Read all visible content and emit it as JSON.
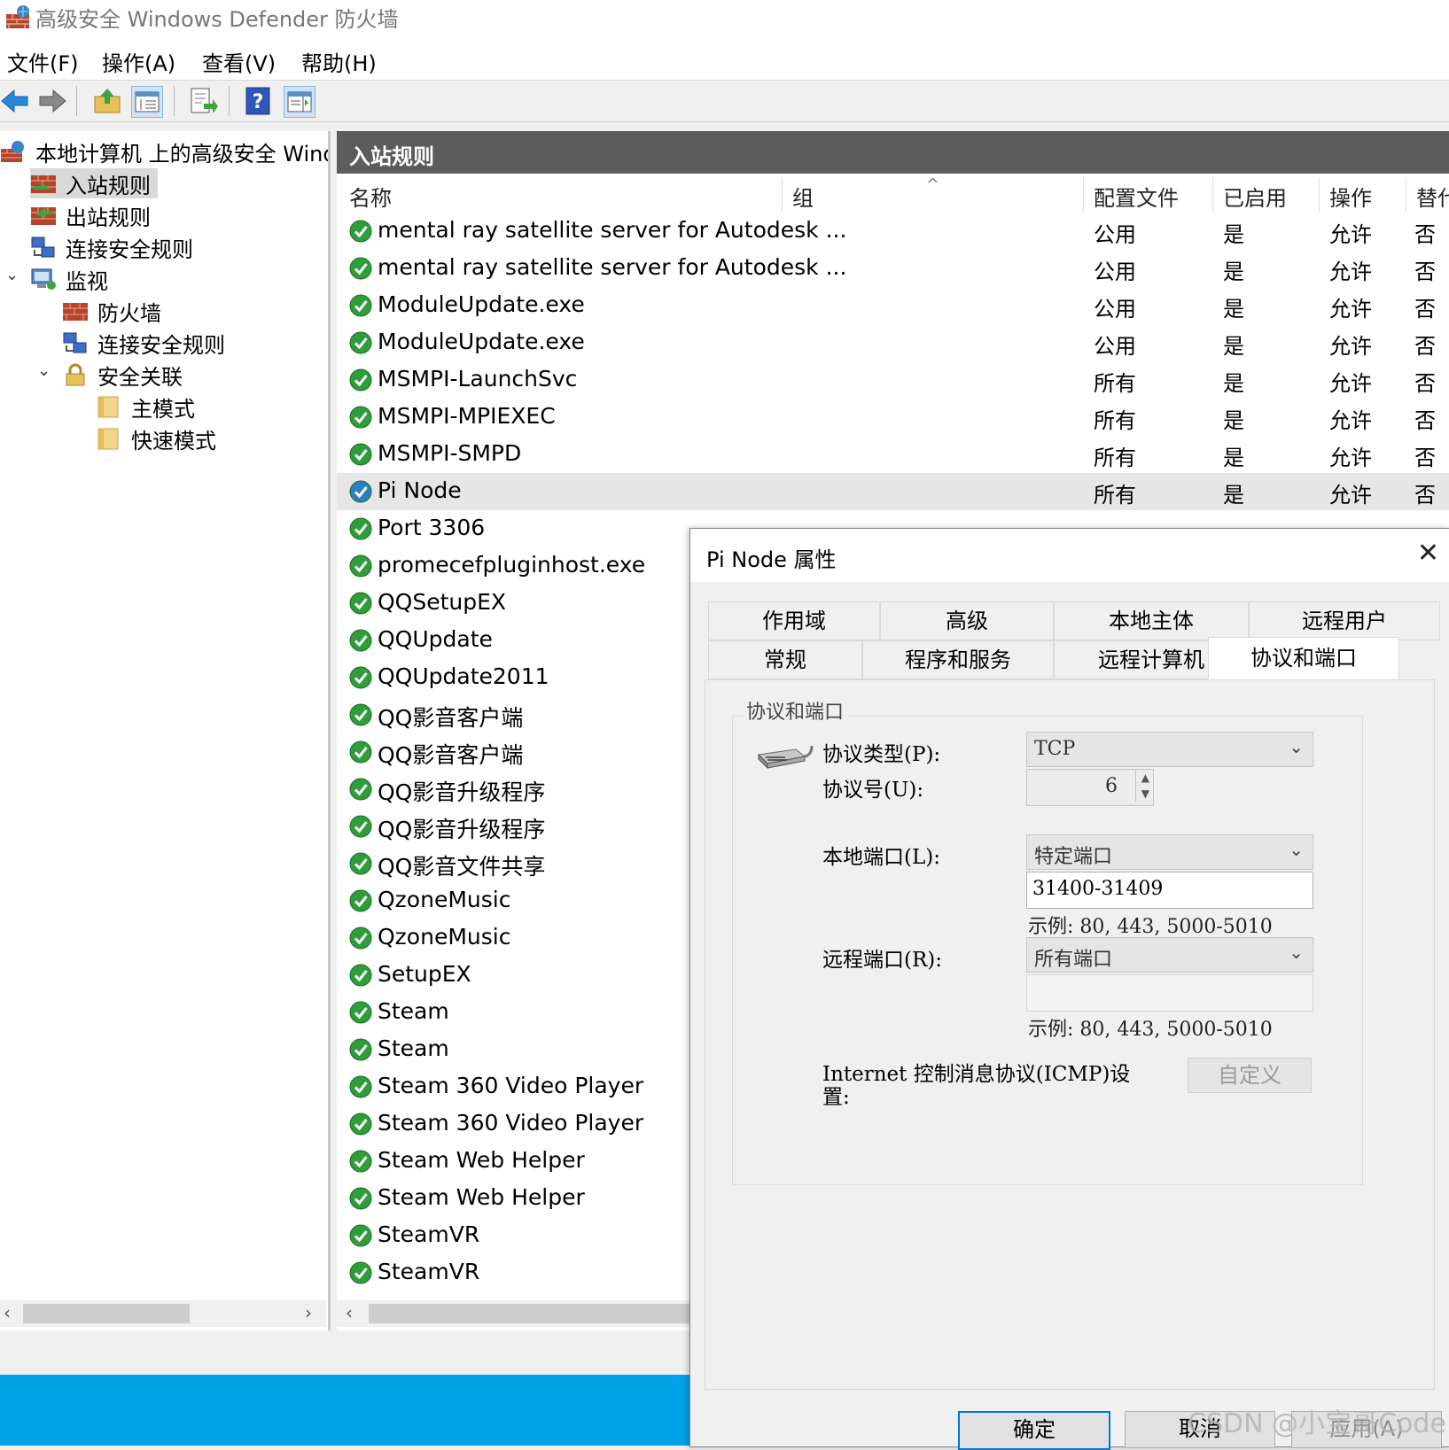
{
  "window": {
    "title": "高级安全 Windows Defender 防火墙"
  },
  "menu": [
    "文件(F)",
    "操作(A)",
    "查看(V)",
    "帮助(H)"
  ],
  "toolbar": [
    "back-icon",
    "forward-icon",
    "up-folder-icon",
    "show-hide-console-icon",
    "export-list-icon",
    "help-icon",
    "action-pane-icon"
  ],
  "tree": {
    "root": "本地计算机 上的高级安全 Windows Defender 防火墙",
    "items": [
      "入站规则",
      "出站规则",
      "连接安全规则",
      "监视"
    ],
    "monitor_children": [
      "防火墙",
      "连接安全规则",
      "安全关联"
    ],
    "sa_children": [
      "主模式",
      "快速模式"
    ]
  },
  "list": {
    "header": "入站规则",
    "columns": [
      "名称",
      "组",
      "配置文件",
      "已启用",
      "操作",
      "替代"
    ],
    "rows": [
      {
        "name": "mental ray satellite server for Autodesk ...",
        "profile": "公用",
        "enabled": "是",
        "action": "允许",
        "override": "否"
      },
      {
        "name": "mental ray satellite server for Autodesk ...",
        "profile": "公用",
        "enabled": "是",
        "action": "允许",
        "override": "否"
      },
      {
        "name": "ModuleUpdate.exe",
        "profile": "公用",
        "enabled": "是",
        "action": "允许",
        "override": "否"
      },
      {
        "name": "ModuleUpdate.exe",
        "profile": "公用",
        "enabled": "是",
        "action": "允许",
        "override": "否"
      },
      {
        "name": "MSMPI-LaunchSvc",
        "profile": "所有",
        "enabled": "是",
        "action": "允许",
        "override": "否"
      },
      {
        "name": "MSMPI-MPIEXEC",
        "profile": "所有",
        "enabled": "是",
        "action": "允许",
        "override": "否"
      },
      {
        "name": "MSMPI-SMPD",
        "profile": "所有",
        "enabled": "是",
        "action": "允许",
        "override": "否"
      },
      {
        "name": "Pi Node",
        "profile": "所有",
        "enabled": "是",
        "action": "允许",
        "override": "否",
        "selected": true
      },
      {
        "name": "Port 3306"
      },
      {
        "name": "promecefpluginhost.exe"
      },
      {
        "name": "QQSetupEX"
      },
      {
        "name": "QQUpdate"
      },
      {
        "name": "QQUpdate2011"
      },
      {
        "name": "QQ影音客户端"
      },
      {
        "name": "QQ影音客户端"
      },
      {
        "name": "QQ影音升级程序"
      },
      {
        "name": "QQ影音升级程序"
      },
      {
        "name": "QQ影音文件共享"
      },
      {
        "name": "QzoneMusic"
      },
      {
        "name": "QzoneMusic"
      },
      {
        "name": "SetupEX"
      },
      {
        "name": "Steam"
      },
      {
        "name": "Steam"
      },
      {
        "name": "Steam 360 Video Player"
      },
      {
        "name": "Steam 360 Video Player"
      },
      {
        "name": "Steam Web Helper"
      },
      {
        "name": "Steam Web Helper"
      },
      {
        "name": "SteamVR"
      },
      {
        "name": "SteamVR"
      }
    ]
  },
  "dialog": {
    "title": "Pi Node 属性",
    "tabs_row1": [
      "作用域",
      "高级",
      "本地主体",
      "远程用户"
    ],
    "tabs_row2": [
      "常规",
      "程序和服务",
      "远程计算机",
      "协议和端口"
    ],
    "active_tab": "协议和端口",
    "group_title": "协议和端口",
    "protocol_type_label": "协议类型(P):",
    "protocol_type_value": "TCP",
    "protocol_number_label": "协议号(U):",
    "protocol_number_value": "6",
    "local_port_label": "本地端口(L):",
    "local_port_mode": "特定端口",
    "local_port_value": "31400-31409",
    "example": "示例: 80, 443, 5000-5010",
    "remote_port_label": "远程端口(R):",
    "remote_port_mode": "所有端口",
    "remote_port_value": "",
    "icmp_label": "Internet 控制消息协议(ICMP)设置:",
    "customize_button": "自定义",
    "ok_button": "确定",
    "cancel_button": "取消",
    "apply_button": "应用(A)"
  },
  "watermark": "CSDN @小宝哥Code"
}
